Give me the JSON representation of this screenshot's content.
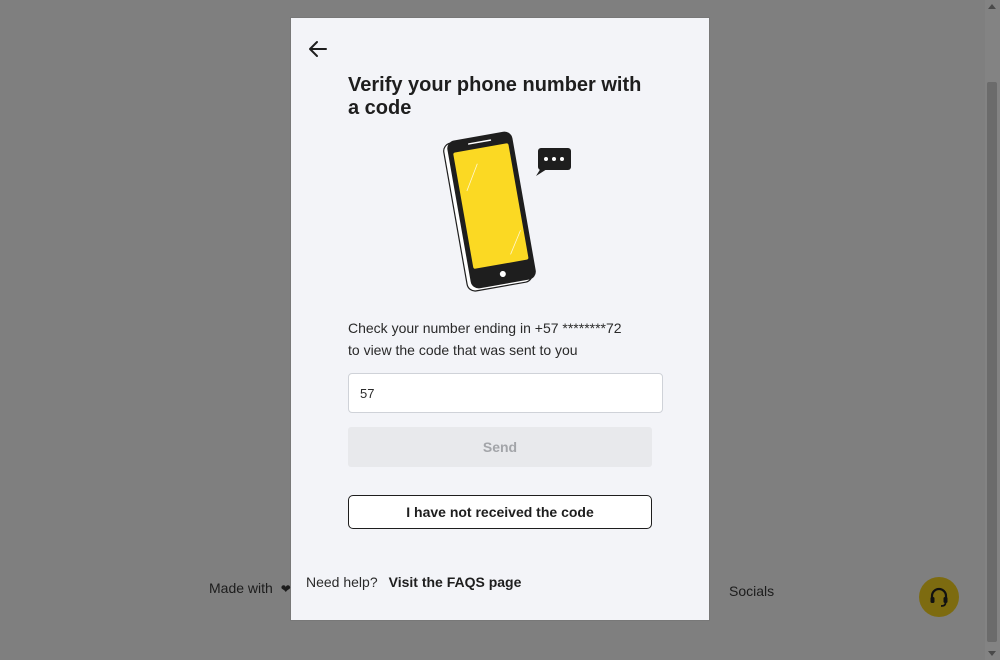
{
  "background": {
    "made_with": "Made with",
    "socials": "Socials"
  },
  "modal": {
    "title": "Verify your phone number with a code",
    "description_line1": "Check your number ending in +57 ********72",
    "description_line2": "to view the code that was sent to you",
    "code_input_value": "57",
    "send_label": "Send",
    "not_received_label": "I have not received the code",
    "help_text": "Need help?",
    "faq_link": "Visit the FAQS page"
  },
  "colors": {
    "overlay": "#7f7f7f",
    "modal_bg": "#f3f4f8",
    "phone_screen": "#fbd923",
    "support_button": "#7d6b10"
  },
  "icons": {
    "back": "arrow-left-icon",
    "illustration": "phone-message-illustration",
    "heart": "heart-icon",
    "support": "headset-icon"
  }
}
